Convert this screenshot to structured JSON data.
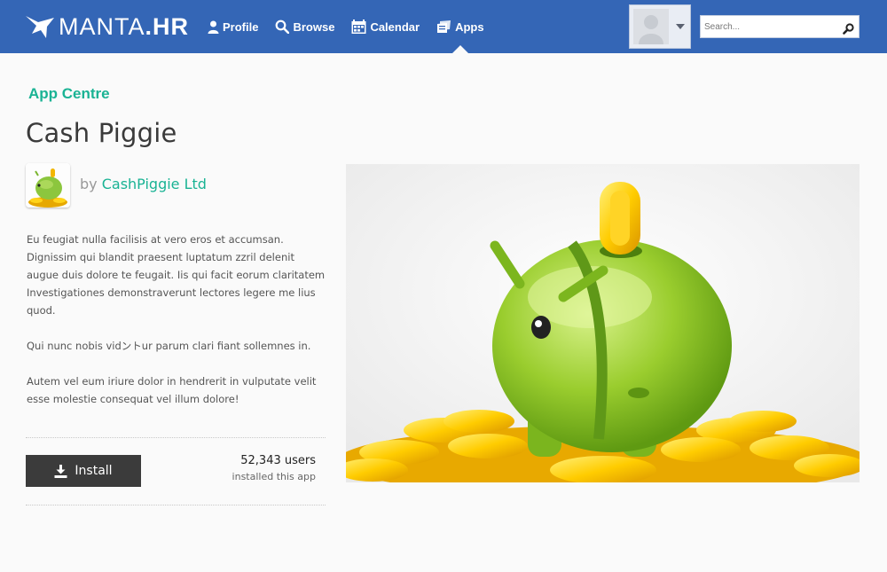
{
  "brand": {
    "name_part1": "MANTA",
    "name_part2": ".HR"
  },
  "nav": {
    "items": [
      {
        "label": "Profile",
        "icon": "person-icon"
      },
      {
        "label": "Browse",
        "icon": "search-icon"
      },
      {
        "label": "Calendar",
        "icon": "calendar-icon"
      },
      {
        "label": "Apps",
        "icon": "apps-icon",
        "active": true
      }
    ]
  },
  "search": {
    "placeholder": "Search...",
    "value": ""
  },
  "breadcrumb": "App Centre",
  "app": {
    "title": "Cash Piggie",
    "by_label": "by",
    "developer": "CashPiggie Ltd",
    "description": [
      "Eu feugiat nulla facilisis at vero eros et accumsan. Dignissim qui blandit praesent luptatum zzril delenit augue duis dolore te feugait. Iis qui facit eorum clari­tatem Investigationes demonstraverunt lectores legere me lius quod.",
      "Qui nunc nobis vidントur parum clari fiant sollemnes in.",
      "Autem vel eum iriure dolor in hendrerit in vulputate velit esse molestie consequat vel illum dolore!"
    ],
    "install_label": "Install",
    "users_count": "52,343 users",
    "users_note": "installed this app"
  },
  "colors": {
    "header": "#3466b6",
    "accent": "#1ab394",
    "button": "#3b3b3b"
  }
}
